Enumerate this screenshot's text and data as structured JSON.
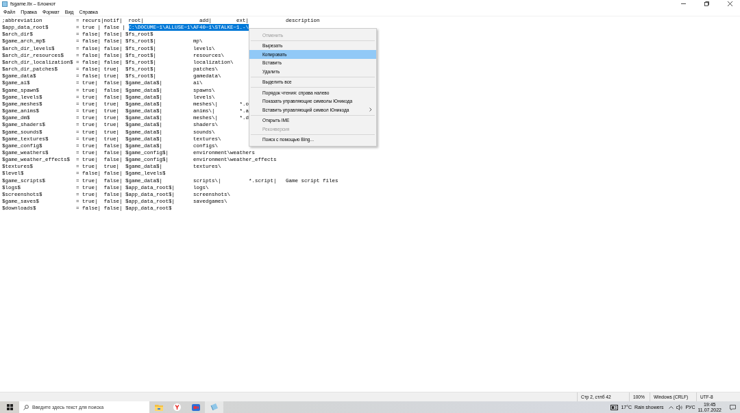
{
  "window": {
    "title": "fsgame.ltx – Блокнот"
  },
  "menu_bar": [
    "Файл",
    "Правка",
    "Формат",
    "Вид",
    "Справка"
  ],
  "editor": {
    "lines": [
      {
        "text": ";abbreviation           = recurs|notif|  root|                  add|        ext|            description"
      },
      {
        "text": "$app_data_root$         = true | false | ",
        "selected_text": "C:\\DOCUME~1\\ALLUSE~1\\AF40~1\\STALKE~1.-\\"
      },
      {
        "text": "$arch_dir$              = false| false| $fs_root$"
      },
      {
        "text": "$game_arch_mp$          = false| false| $fs_root$|            mp\\"
      },
      {
        "text": "$arch_dir_levels$       = false| false| $fs_root$|            levels\\"
      },
      {
        "text": "$arch_dir_resources$    = false| false| $fs_root$|            resources\\"
      },
      {
        "text": "$arch_dir_localization$ = false| false| $fs_root$|            localization\\"
      },
      {
        "text": "$arch_dir_patches$      = false| true|  $fs_root$|            patches\\"
      },
      {
        "text": "$game_data$             = false| true|  $fs_root$|            gamedata\\"
      },
      {
        "text": "$game_ai$               = true|  false| $game_data$|          ai\\"
      },
      {
        "text": "$game_spawn$            = true|  false| $game_data$|          spawns\\"
      },
      {
        "text": "$game_levels$           = true|  false| $game_data$|          levels\\"
      },
      {
        "text": "$game_meshes$           = true|  true|  $game_data$|          meshes\\|       *.o"
      },
      {
        "text": "$game_anims$            = true|  true|  $game_data$|          anims\\|        *.a"
      },
      {
        "text": "$game_dm$               = true|  true|  $game_data$|          meshes\\|       *.d"
      },
      {
        "text": "$game_shaders$          = true|  true|  $game_data$|          shaders\\"
      },
      {
        "text": "$game_sounds$           = true|  true|  $game_data$|          sounds\\"
      },
      {
        "text": "$game_textures$         = true|  true|  $game_data$|          textures\\"
      },
      {
        "text": "$game_config$           = true|  false| $game_data$|          configs\\"
      },
      {
        "text": "$game_weathers$         = true|  false| $game_config$|        environment\\weathers"
      },
      {
        "text": "$game_weather_effects$  = true|  false| $game_config$|        environment\\weather_effects"
      },
      {
        "text": "$textures$              = true|  true|  $game_data$|          textures\\"
      },
      {
        "text": "$level$                 = false| false| $game_levels$"
      },
      {
        "text": "$game_scripts$          = true|  false| $game_data$|          scripts\\|         *.script|   Game script files"
      },
      {
        "text": "$logs$                  = true|  false| $app_data_root$|      logs\\"
      },
      {
        "text": "$screenshots$           = true|  false| $app_data_root$|      screenshots\\"
      },
      {
        "text": "$game_saves$            = true|  false| $app_data_root$|      savedgames\\"
      },
      {
        "text": "$downloads$             = false| false| $app_data_root$"
      }
    ]
  },
  "context_menu": {
    "items": [
      {
        "kind": "item",
        "label": "Отменить",
        "disabled": true,
        "selected": false,
        "submenu": false
      },
      {
        "kind": "separator"
      },
      {
        "kind": "item",
        "label": "Вырезать",
        "disabled": false,
        "selected": false,
        "submenu": false
      },
      {
        "kind": "item",
        "label": "Копировать",
        "disabled": false,
        "selected": true,
        "submenu": false
      },
      {
        "kind": "item",
        "label": "Вставить",
        "disabled": false,
        "selected": false,
        "submenu": false
      },
      {
        "kind": "item",
        "label": "Удалить",
        "disabled": false,
        "selected": false,
        "submenu": false
      },
      {
        "kind": "separator"
      },
      {
        "kind": "item",
        "label": "Выделить все",
        "disabled": false,
        "selected": false,
        "submenu": false
      },
      {
        "kind": "separator"
      },
      {
        "kind": "item",
        "label": "Порядок чтения: справа налево",
        "disabled": false,
        "selected": false,
        "submenu": false
      },
      {
        "kind": "item",
        "label": "Показать управляющие символы Юникода",
        "disabled": false,
        "selected": false,
        "submenu": false
      },
      {
        "kind": "item",
        "label": "Вставить управляющий символ Юникода",
        "disabled": false,
        "selected": false,
        "submenu": true
      },
      {
        "kind": "separator"
      },
      {
        "kind": "item",
        "label": "Открыть IME",
        "disabled": false,
        "selected": false,
        "submenu": false
      },
      {
        "kind": "item",
        "label": "Реконверсия",
        "disabled": true,
        "selected": false,
        "submenu": false
      },
      {
        "kind": "separator"
      },
      {
        "kind": "item",
        "label": "Поиск с помощью Bing...",
        "disabled": false,
        "selected": false,
        "submenu": false
      }
    ]
  },
  "status_bar": {
    "position": "Стр 2, стлб 42",
    "zoom": "100%",
    "line_endings": "Windows (CRLF)",
    "encoding": "UTF-8"
  },
  "taskbar": {
    "search_placeholder": "Введите здесь текст для поиска",
    "apps": [
      {
        "kind": "folder",
        "active": false
      },
      {
        "kind": "browser",
        "active": false
      },
      {
        "kind": "camera",
        "active": false
      },
      {
        "kind": "notepad",
        "active": true
      }
    ],
    "temperature": "17°C",
    "weather": "Rain showers",
    "language": "РУС",
    "time": "19:45",
    "date": "11.07.2022"
  }
}
